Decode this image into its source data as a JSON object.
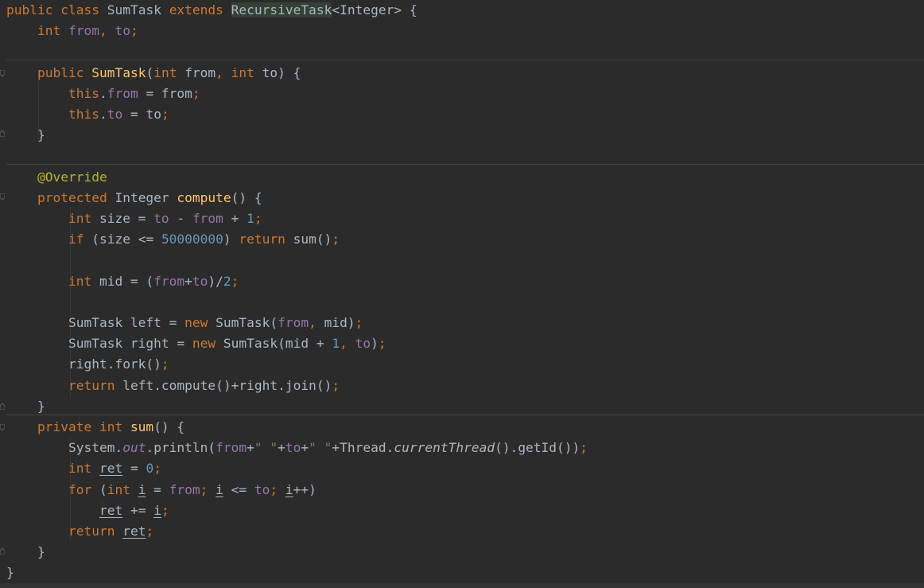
{
  "editor": {
    "language": "java",
    "colors": {
      "background": "#2b2b2b",
      "default": "#a9b7c6",
      "keyword": "#cc7832",
      "field": "#9876aa",
      "method_decl": "#ffc66d",
      "number": "#6897bb",
      "annotation": "#bbb529",
      "string": "#6a8759"
    },
    "lines": [
      [
        [
          "kw",
          "public "
        ],
        [
          "kw",
          "class "
        ],
        [
          "cls",
          "SumTask "
        ],
        [
          "kw",
          "extends "
        ],
        [
          "hl",
          "RecursiveTask"
        ],
        [
          "cls",
          "<Integer> {"
        ]
      ],
      [
        [
          "txt",
          "    "
        ],
        [
          "kw",
          "int "
        ],
        [
          "fld",
          "from"
        ],
        [
          "kw",
          ", "
        ],
        [
          "fld",
          "to"
        ],
        [
          "kw",
          ";"
        ]
      ],
      [],
      [
        [
          "txt",
          "    "
        ],
        [
          "kw",
          "public "
        ],
        [
          "fn",
          "SumTask"
        ],
        [
          "cls",
          "("
        ],
        [
          "kw",
          "int "
        ],
        [
          "cls",
          "from"
        ],
        [
          "kw",
          ", "
        ],
        [
          "kw",
          "int "
        ],
        [
          "cls",
          "to) {"
        ]
      ],
      [
        [
          "txt",
          "        "
        ],
        [
          "kw",
          "this"
        ],
        [
          "cls",
          "."
        ],
        [
          "fld",
          "from "
        ],
        [
          "cls",
          "= from"
        ],
        [
          "kw",
          ";"
        ]
      ],
      [
        [
          "txt",
          "        "
        ],
        [
          "kw",
          "this"
        ],
        [
          "cls",
          "."
        ],
        [
          "fld",
          "to "
        ],
        [
          "cls",
          "= to"
        ],
        [
          "kw",
          ";"
        ]
      ],
      [
        [
          "txt",
          "    "
        ],
        [
          "cls",
          "}"
        ]
      ],
      [],
      [
        [
          "txt",
          "    "
        ],
        [
          "ann",
          "@Override"
        ]
      ],
      [
        [
          "txt",
          "    "
        ],
        [
          "kw",
          "protected "
        ],
        [
          "cls",
          "Integer "
        ],
        [
          "fn",
          "compute"
        ],
        [
          "cls",
          "() {"
        ]
      ],
      [
        [
          "txt",
          "        "
        ],
        [
          "kw",
          "int "
        ],
        [
          "cls",
          "size = "
        ],
        [
          "fld",
          "to "
        ],
        [
          "cls",
          "- "
        ],
        [
          "fld",
          "from "
        ],
        [
          "cls",
          "+ "
        ],
        [
          "num",
          "1"
        ],
        [
          "kw",
          ";"
        ]
      ],
      [
        [
          "txt",
          "        "
        ],
        [
          "kw",
          "if "
        ],
        [
          "cls",
          "(size <= "
        ],
        [
          "num",
          "50000000"
        ],
        [
          "cls",
          ") "
        ],
        [
          "kw",
          "return "
        ],
        [
          "cls",
          "sum()"
        ],
        [
          "kw",
          ";"
        ]
      ],
      [],
      [
        [
          "txt",
          "        "
        ],
        [
          "kw",
          "int "
        ],
        [
          "cls",
          "mid = ("
        ],
        [
          "fld",
          "from"
        ],
        [
          "cls",
          "+"
        ],
        [
          "fld",
          "to"
        ],
        [
          "cls",
          ")/"
        ],
        [
          "num",
          "2"
        ],
        [
          "kw",
          ";"
        ]
      ],
      [],
      [
        [
          "txt",
          "        "
        ],
        [
          "cls",
          "SumTask left = "
        ],
        [
          "kw",
          "new "
        ],
        [
          "cls",
          "SumTask("
        ],
        [
          "fld",
          "from"
        ],
        [
          "kw",
          ", "
        ],
        [
          "cls",
          "mid)"
        ],
        [
          "kw",
          ";"
        ]
      ],
      [
        [
          "txt",
          "        "
        ],
        [
          "cls",
          "SumTask right = "
        ],
        [
          "kw",
          "new "
        ],
        [
          "cls",
          "SumTask(mid + "
        ],
        [
          "num",
          "1"
        ],
        [
          "kw",
          ", "
        ],
        [
          "fld",
          "to"
        ],
        [
          "cls",
          ")"
        ],
        [
          "kw",
          ";"
        ]
      ],
      [
        [
          "txt",
          "        "
        ],
        [
          "cls",
          "right.fork()"
        ],
        [
          "kw",
          ";"
        ]
      ],
      [
        [
          "txt",
          "        "
        ],
        [
          "kw",
          "return "
        ],
        [
          "cls",
          "left.compute()+right.join()"
        ],
        [
          "kw",
          ";"
        ]
      ],
      [
        [
          "txt",
          "    "
        ],
        [
          "cls",
          "}"
        ]
      ],
      [
        [
          "txt",
          "    "
        ],
        [
          "kw",
          "private "
        ],
        [
          "kw",
          "int "
        ],
        [
          "fn",
          "sum"
        ],
        [
          "cls",
          "() {"
        ]
      ],
      [
        [
          "txt",
          "        "
        ],
        [
          "cls",
          "System."
        ],
        [
          "fldit",
          "out"
        ],
        [
          "cls",
          ".println("
        ],
        [
          "fld",
          "from"
        ],
        [
          "cls",
          "+"
        ],
        [
          "str",
          "\" \""
        ],
        [
          "cls",
          "+"
        ],
        [
          "fld",
          "to"
        ],
        [
          "cls",
          "+"
        ],
        [
          "str",
          "\" \""
        ],
        [
          "cls",
          "+Thread."
        ],
        [
          "it",
          "currentThread"
        ],
        [
          "cls",
          "().getId())"
        ],
        [
          "kw",
          ";"
        ]
      ],
      [
        [
          "txt",
          "        "
        ],
        [
          "kw",
          "int "
        ],
        [
          "ul",
          "ret"
        ],
        [
          "cls",
          " = "
        ],
        [
          "num",
          "0"
        ],
        [
          "kw",
          ";"
        ]
      ],
      [
        [
          "txt",
          "        "
        ],
        [
          "kw",
          "for "
        ],
        [
          "cls",
          "("
        ],
        [
          "kw",
          "int "
        ],
        [
          "ul",
          "i"
        ],
        [
          "cls",
          " = "
        ],
        [
          "fld",
          "from"
        ],
        [
          "kw",
          "; "
        ],
        [
          "ul",
          "i"
        ],
        [
          "cls",
          " <= "
        ],
        [
          "fld",
          "to"
        ],
        [
          "kw",
          "; "
        ],
        [
          "ul",
          "i"
        ],
        [
          "cls",
          "++)"
        ]
      ],
      [
        [
          "txt",
          "            "
        ],
        [
          "ul",
          "ret"
        ],
        [
          "cls",
          " += "
        ],
        [
          "ul",
          "i"
        ],
        [
          "kw",
          ";"
        ]
      ],
      [
        [
          "txt",
          "        "
        ],
        [
          "kw",
          "return "
        ],
        [
          "ul",
          "ret"
        ],
        [
          "kw",
          ";"
        ]
      ],
      [
        [
          "txt",
          "    "
        ],
        [
          "cls",
          "}"
        ]
      ],
      [
        [
          "cls",
          "}"
        ]
      ]
    ]
  }
}
